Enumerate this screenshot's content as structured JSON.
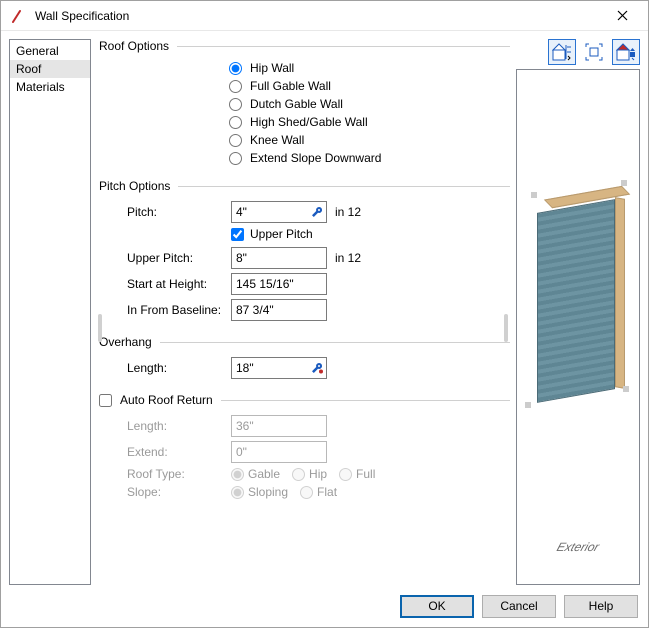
{
  "window": {
    "title": "Wall Specification"
  },
  "sidebar": {
    "items": [
      {
        "label": "General",
        "selected": false
      },
      {
        "label": "Roof",
        "selected": true
      },
      {
        "label": "Materials",
        "selected": false
      }
    ]
  },
  "roof_options": {
    "legend": "Roof Options",
    "selected": "hip",
    "options": {
      "hip": "Hip Wall",
      "full_gable": "Full Gable Wall",
      "dutch_gable": "Dutch Gable Wall",
      "high_shed": "High Shed/Gable Wall",
      "knee": "Knee Wall",
      "extend_slope": "Extend Slope Downward"
    }
  },
  "pitch_options": {
    "legend": "Pitch Options",
    "pitch_label": "Pitch:",
    "pitch_value": "4\"",
    "pitch_suffix": "in 12",
    "upper_pitch_checkbox": "Upper Pitch",
    "upper_pitch_checked": true,
    "upper_pitch_label": "Upper Pitch:",
    "upper_pitch_value": "8\"",
    "upper_pitch_suffix": "in 12",
    "start_height_label": "Start at Height:",
    "start_height_value": "145 15/16\"",
    "in_from_baseline_label": "In From Baseline:",
    "in_from_baseline_value": "87 3/4\""
  },
  "overhang": {
    "legend": "Overhang",
    "length_label": "Length:",
    "length_value": "18\""
  },
  "auto_roof_return": {
    "legend": "Auto Roof Return",
    "checked": false,
    "length_label": "Length:",
    "length_value": "36\"",
    "extend_label": "Extend:",
    "extend_value": "0\"",
    "roof_type_label": "Roof Type:",
    "roof_type_options": {
      "gable": "Gable",
      "hip": "Hip",
      "full": "Full"
    },
    "roof_type_selected": "gable",
    "slope_label": "Slope:",
    "slope_options": {
      "sloping": "Sloping",
      "flat": "Flat"
    },
    "slope_selected": "sloping"
  },
  "preview": {
    "caption": "Exterior"
  },
  "buttons": {
    "ok": "OK",
    "cancel": "Cancel",
    "help": "Help"
  },
  "icons": {
    "wrench": "wrench-icon",
    "wrench_red": "wrench-override-icon"
  }
}
